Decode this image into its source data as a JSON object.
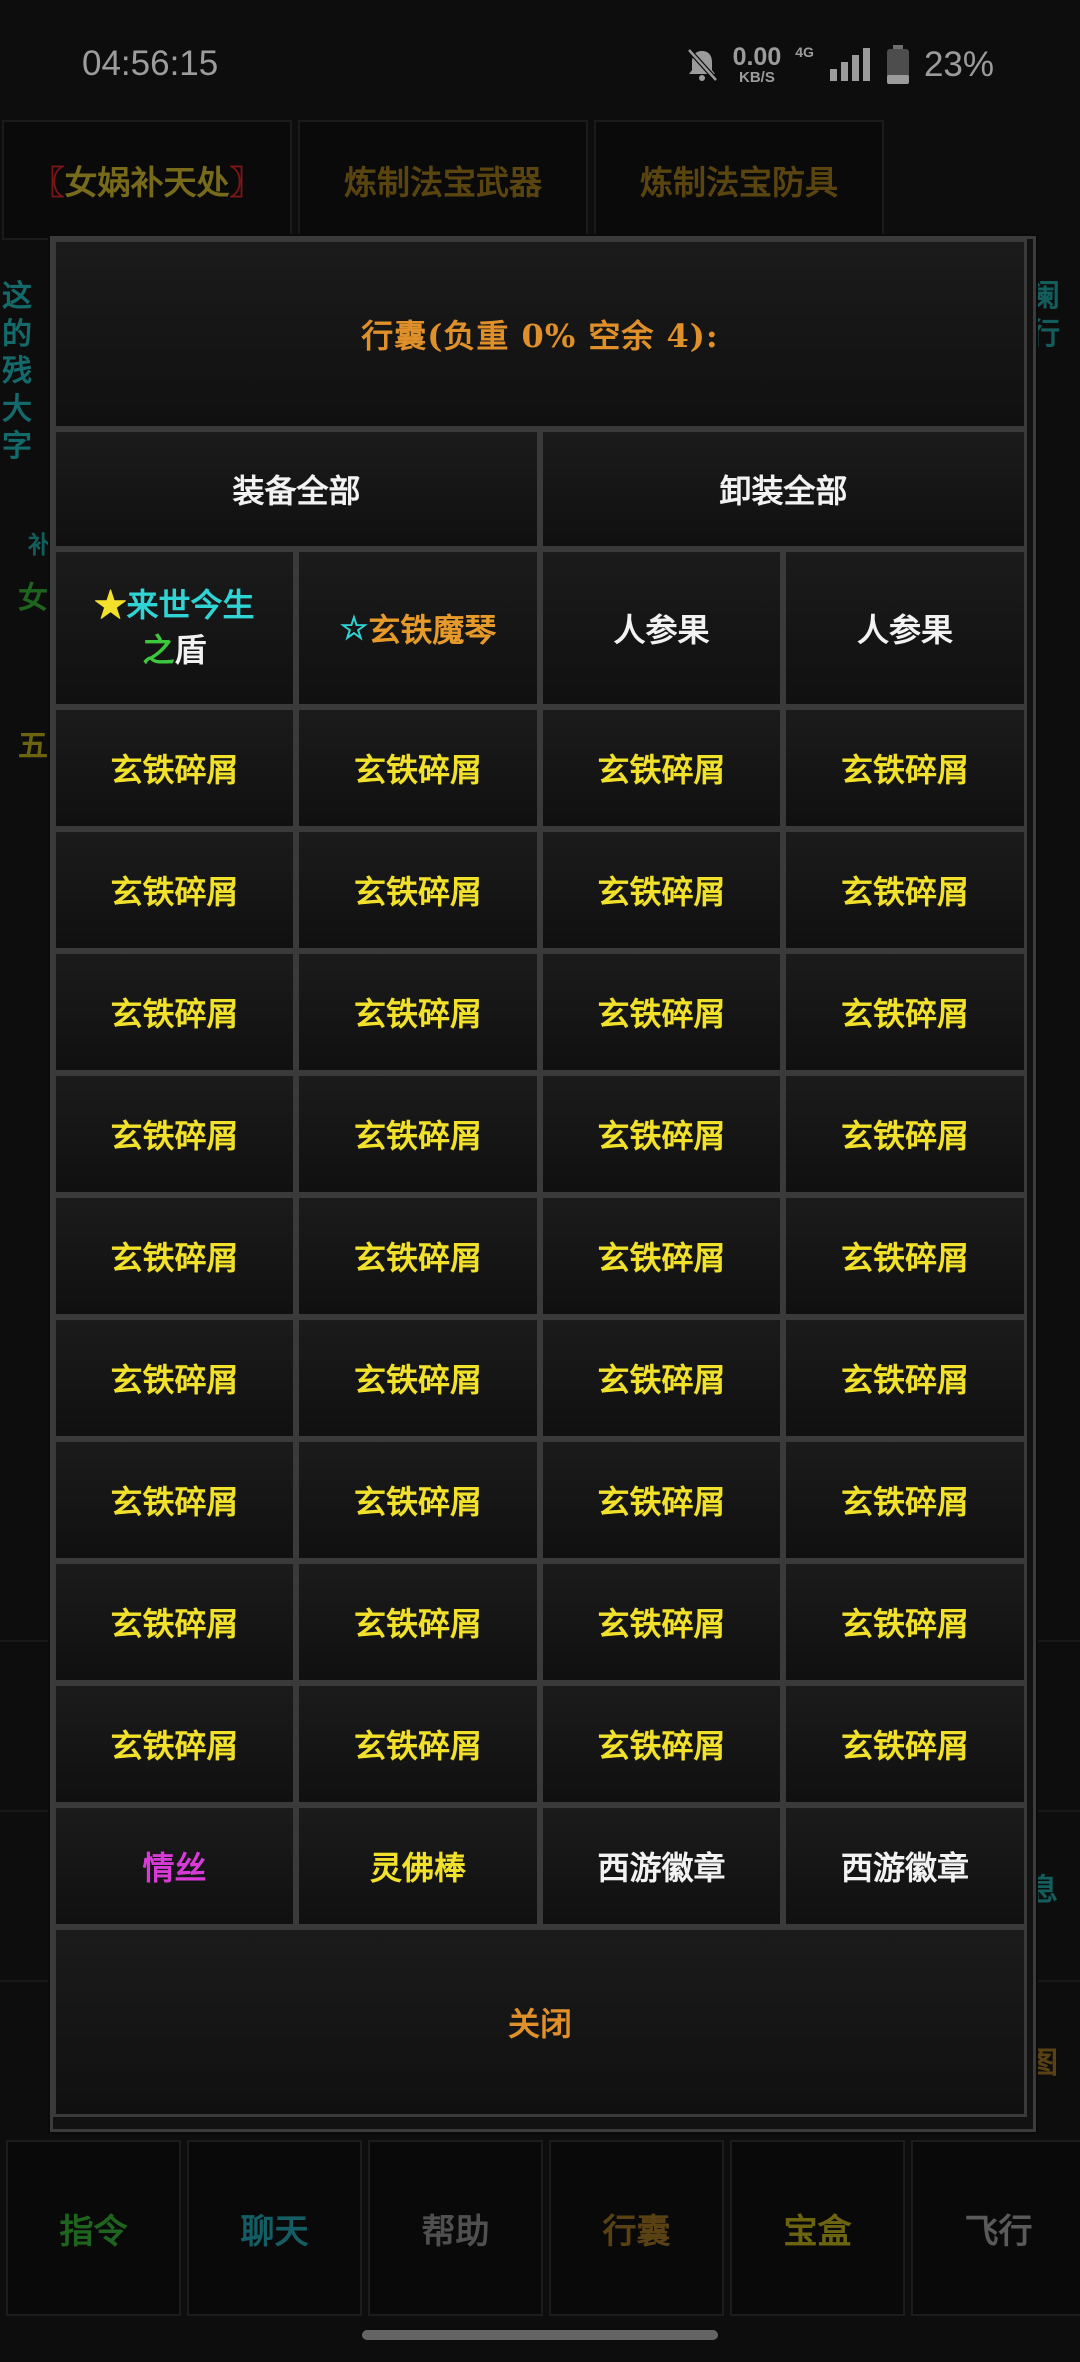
{
  "status_bar": {
    "time": "04:56:15",
    "speed_value": "0.00",
    "speed_unit": "KB/S",
    "network": "4G",
    "battery": "23%"
  },
  "background": {
    "tabs": [
      {
        "open": "〖",
        "label": "女娲补天处",
        "close": "〗"
      },
      {
        "label": "炼制法宝武器"
      },
      {
        "label": "炼制法宝防具"
      }
    ],
    "side_text_left": [
      "这",
      "的",
      "残",
      "大",
      "字"
    ],
    "side_text_right": [
      "阑",
      "行"
    ],
    "side_small": [
      "补",
      "女",
      "五"
    ],
    "right_edge": [
      "息",
      "图"
    ],
    "bottom_buttons": [
      {
        "label": "指令",
        "color": "#2f9a2f"
      },
      {
        "label": "聊天",
        "color": "#1f8f9a"
      },
      {
        "label": "帮助",
        "color": "#7a7a7a"
      },
      {
        "label": "行囊",
        "color": "#8a6520"
      },
      {
        "label": "宝盒",
        "color": "#a89a1a"
      },
      {
        "label": "飞行",
        "color": "#8a8a8a"
      }
    ]
  },
  "dialog": {
    "title": "行囊(负重 0% 空余 4):",
    "equip_all": "装备全部",
    "unequip_all": "卸装全部",
    "close": "关闭",
    "items": [
      {
        "star": "★",
        "name_a": "来世今生",
        "name_b": "之",
        "name_c": "盾"
      },
      {
        "star": "☆",
        "name": "玄铁魔琴"
      },
      {
        "name": "人参果"
      },
      {
        "name": "人参果"
      },
      {
        "name": "玄铁碎屑"
      },
      {
        "name": "玄铁碎屑"
      },
      {
        "name": "玄铁碎屑"
      },
      {
        "name": "玄铁碎屑"
      },
      {
        "name": "玄铁碎屑"
      },
      {
        "name": "玄铁碎屑"
      },
      {
        "name": "玄铁碎屑"
      },
      {
        "name": "玄铁碎屑"
      },
      {
        "name": "玄铁碎屑"
      },
      {
        "name": "玄铁碎屑"
      },
      {
        "name": "玄铁碎屑"
      },
      {
        "name": "玄铁碎屑"
      },
      {
        "name": "玄铁碎屑"
      },
      {
        "name": "玄铁碎屑"
      },
      {
        "name": "玄铁碎屑"
      },
      {
        "name": "玄铁碎屑"
      },
      {
        "name": "玄铁碎屑"
      },
      {
        "name": "玄铁碎屑"
      },
      {
        "name": "玄铁碎屑"
      },
      {
        "name": "玄铁碎屑"
      },
      {
        "name": "玄铁碎屑"
      },
      {
        "name": "玄铁碎屑"
      },
      {
        "name": "玄铁碎屑"
      },
      {
        "name": "玄铁碎屑"
      },
      {
        "name": "玄铁碎屑"
      },
      {
        "name": "玄铁碎屑"
      },
      {
        "name": "玄铁碎屑"
      },
      {
        "name": "玄铁碎屑"
      },
      {
        "name": "玄铁碎屑"
      },
      {
        "name": "玄铁碎屑"
      },
      {
        "name": "玄铁碎屑"
      },
      {
        "name": "玄铁碎屑"
      },
      {
        "name": "玄铁碎屑"
      },
      {
        "name": "玄铁碎屑"
      },
      {
        "name": "玄铁碎屑"
      },
      {
        "name": "玄铁碎屑"
      },
      {
        "name": "情丝"
      },
      {
        "name": "灵佛棒"
      },
      {
        "name": "西游徽章"
      },
      {
        "name": "西游徽章"
      }
    ]
  }
}
